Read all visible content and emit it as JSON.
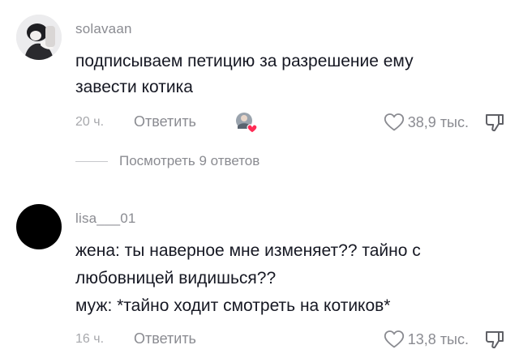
{
  "comments": [
    {
      "username": "solavaan",
      "lines": [
        "подписываем петицию за разрешение ему",
        "завести котика"
      ],
      "time": "20 ч.",
      "reply_label": "Ответить",
      "likes": "38,9 тыс."
    },
    {
      "username": "lisa___01",
      "lines": [
        "жена: ты наверное мне изменяет?? тайно с",
        "любовницей видишься??",
        "муж: *тайно ходит смотреть на котиков*"
      ],
      "time": "16 ч.",
      "reply_label": "Ответить",
      "likes": "13,8 тыс."
    }
  ],
  "view_replies_label": "Посмотреть 9 ответов",
  "colors": {
    "text_primary": "#161823",
    "text_secondary": "#8a8b91",
    "creator_heart": "#fe2c55"
  },
  "icons": [
    "heart-outline-icon",
    "thumbs-down-icon",
    "creator-liked-badge-icon"
  ]
}
